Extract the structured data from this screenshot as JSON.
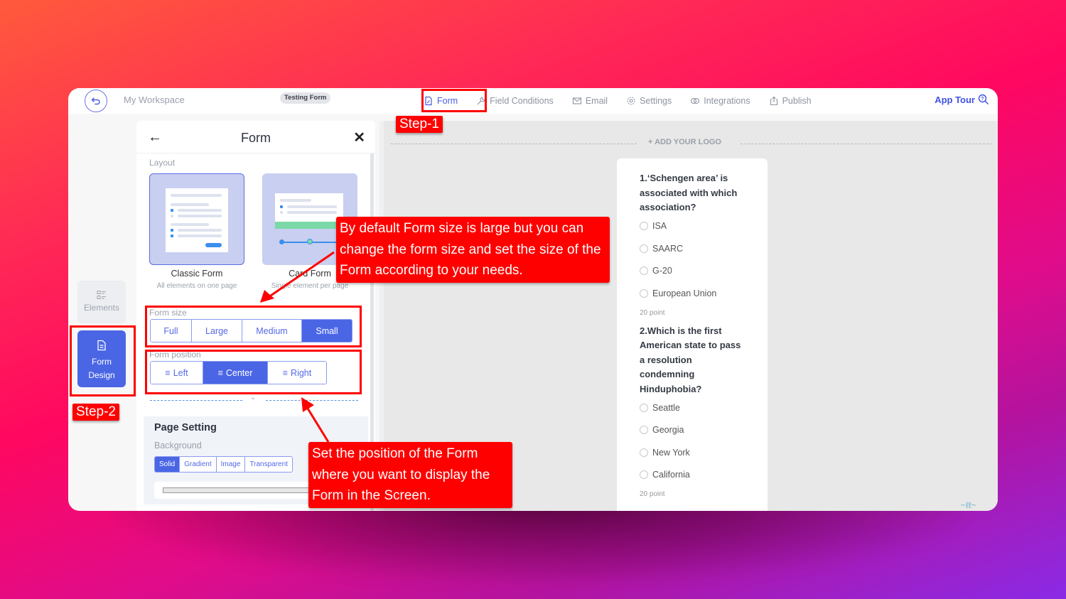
{
  "topbar": {
    "workspace": "My Workspace",
    "form_title": "Testing Form",
    "nav": [
      {
        "label": "Form",
        "icon": "document-edit-icon",
        "active": true
      },
      {
        "label": "Field Conditions",
        "icon": "wrench-icon",
        "active": false
      },
      {
        "label": "Email",
        "icon": "envelope-icon",
        "active": false
      },
      {
        "label": "Settings",
        "icon": "gear-icon",
        "active": false
      },
      {
        "label": "Integrations",
        "icon": "link-rings-icon",
        "active": false
      },
      {
        "label": "Publish",
        "icon": "share-up-icon",
        "active": false
      }
    ],
    "app_tour": "App Tour"
  },
  "rail": {
    "elements": "Elements",
    "form_design_line1": "Form",
    "form_design_line2": "Design"
  },
  "panel": {
    "title": "Form",
    "layout_label": "Layout",
    "layouts": [
      {
        "name": "Classic Form",
        "desc": "All elements on one page",
        "selected": true
      },
      {
        "name": "Card Form",
        "desc": "Single element per page",
        "selected": false
      }
    ],
    "form_size_label": "Form size",
    "form_sizes": [
      "Full",
      "Large",
      "Medium",
      "Small"
    ],
    "form_size_selected": "Small",
    "form_position_label": "Form position",
    "form_positions": [
      "Left",
      "Center",
      "Right"
    ],
    "form_position_selected": "Center",
    "page_setting": {
      "title": "Page Setting",
      "background_label": "Background",
      "background_options": [
        "Solid",
        "Gradient",
        "Image",
        "Transparent"
      ],
      "background_selected": "Solid"
    }
  },
  "canvas": {
    "add_logo": "+ ADD YOUR LOGO",
    "questions": [
      {
        "title": "1.‘Schengen area’ is associated with which association?",
        "options": [
          "ISA",
          "SAARC",
          "G-20",
          "European Union"
        ],
        "points": "20 point"
      },
      {
        "title": "2.Which is the first American state to pass a resolution condemning Hinduphobia?",
        "options": [
          "Seattle",
          "Georgia",
          "New York",
          "California"
        ],
        "points": "20 point"
      }
    ]
  },
  "annotations": {
    "step1": "Step-1",
    "step2": "Step-2",
    "callout_size": "By default Form size is large but you can change the form size and set the size of the Form according to your needs.",
    "callout_position": "Set the position of the Form where you want to display the Form in the Screen."
  },
  "colors": {
    "accent": "#4a66e5",
    "annotation_red": "#ff0000",
    "background_gradient_start": "#ff5a3c",
    "background_gradient_end": "#8b2ae6"
  }
}
